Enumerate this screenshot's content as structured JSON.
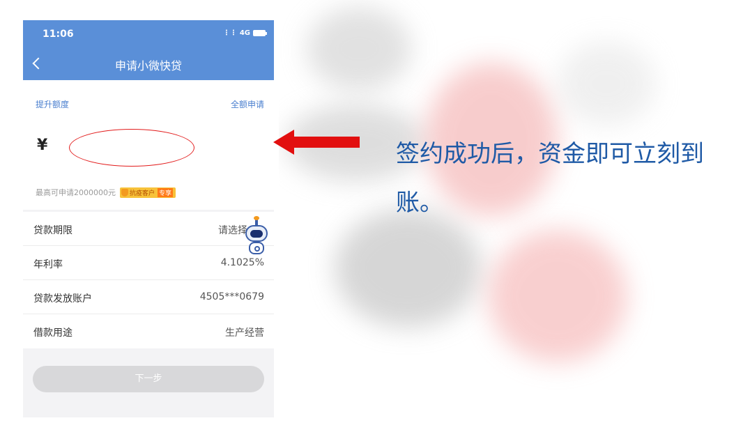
{
  "phone": {
    "status_time": "11:06",
    "status_network": "4G",
    "page_title": "申请小微快贷",
    "link_raise_limit": "提升额度",
    "link_apply_full": "全额申请",
    "currency_symbol": "¥",
    "amount_value": "",
    "max_amount_text": "最高可申请2000000元",
    "badge_text": "抗疫客户",
    "badge_tag": "专享",
    "rows": [
      {
        "label": "贷款期限",
        "value": "请选择"
      },
      {
        "label": "年利率",
        "value": "4.1025%"
      },
      {
        "label": "贷款发放账户",
        "value": "4505***0679"
      },
      {
        "label": "借款用途",
        "value": "生产经营"
      }
    ],
    "next_button": "下一步"
  },
  "caption": "签约成功后，资金即可立刻到账。",
  "colors": {
    "appbar": "#5a8fd8",
    "link": "#4a7fcf",
    "arrow": "#e20f0f",
    "caption": "#1f5aa6"
  },
  "icons": [
    "back-chevron-icon",
    "signal-icon",
    "battery-icon",
    "shield-icon",
    "robot-assistant-icon",
    "left-arrow-icon"
  ]
}
